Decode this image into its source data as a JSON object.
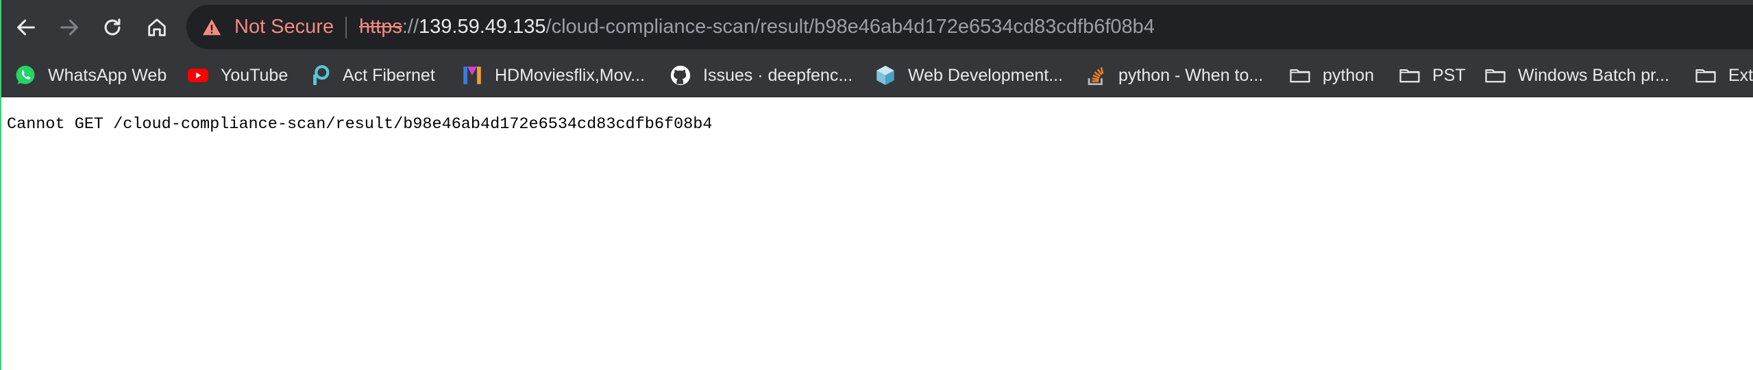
{
  "browser": {
    "security_label": "Not Secure",
    "url": {
      "scheme": "https",
      "separator": "://",
      "host": "139.59.49.135",
      "path": "/cloud-compliance-scan/result/b98e46ab4d172e6534cd83cdfb6f08b4"
    },
    "nav": {
      "back_icon": "arrow-left-icon",
      "forward_icon": "arrow-right-icon",
      "reload_icon": "reload-icon",
      "home_icon": "home-icon"
    }
  },
  "bookmarks": [
    {
      "label": "WhatsApp Web",
      "icon": "whatsapp-icon"
    },
    {
      "label": "YouTube",
      "icon": "youtube-icon"
    },
    {
      "label": "Act Fibernet",
      "icon": "act-fibernet-icon"
    },
    {
      "label": "HDMoviesflix,Mov...",
      "icon": "hdmovies-icon"
    },
    {
      "label": "Issues · deepfenc...",
      "icon": "github-icon"
    },
    {
      "label": "Web Development...",
      "icon": "cube-icon"
    },
    {
      "label": "python - When to...",
      "icon": "stackoverflow-icon"
    },
    {
      "label": "python",
      "icon": "folder-icon"
    },
    {
      "label": "PST",
      "icon": "folder-icon"
    },
    {
      "label": "Windows Batch pr...",
      "icon": "folder-icon"
    },
    {
      "label": "Extr",
      "icon": "folder-icon"
    }
  ],
  "page": {
    "message": "Cannot GET /cloud-compliance-scan/result/b98e46ab4d172e6534cd83cdfb6f08b4"
  },
  "colors": {
    "toolbar_bg": "#35363a",
    "omnibox_bg": "#202124",
    "warning": "#f28b82",
    "edge_accent": "#3ccf7a"
  }
}
